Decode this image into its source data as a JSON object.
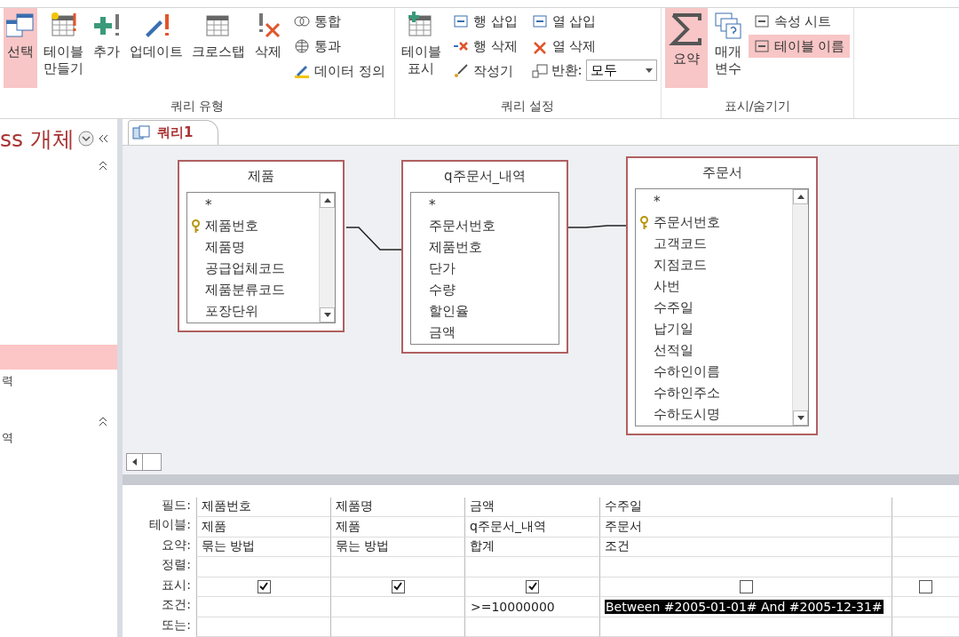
{
  "ribbon": {
    "groups": [
      {
        "label": "쿼리 유형",
        "large": [
          {
            "label": "선택",
            "selected": true
          },
          {
            "label": "테이블\n만들기",
            "selected": false
          },
          {
            "label": "추가",
            "selected": false
          },
          {
            "label": "업데이트",
            "selected": false
          },
          {
            "label": "크로스탭",
            "selected": false
          },
          {
            "label": "삭제",
            "selected": false
          }
        ],
        "small": [
          [
            {
              "label": "통합",
              "selected": false
            },
            {
              "label": "통과",
              "selected": false
            },
            {
              "label": "데이터 정의",
              "selected": false
            }
          ]
        ]
      },
      {
        "label": "쿼리 설정",
        "large": [
          {
            "label": "테이블\n표시",
            "selected": false
          }
        ],
        "small": [
          [
            {
              "label": "행 삽입",
              "selected": false
            },
            {
              "label": "행 삭제",
              "selected": false
            },
            {
              "label": "작성기",
              "selected": false
            }
          ],
          [
            {
              "label": "열 삽입",
              "selected": false
            },
            {
              "label": "열 삭제",
              "selected": false
            }
          ]
        ],
        "return": {
          "label": "반환:",
          "value": "모두"
        }
      },
      {
        "label": "표시/숨기기",
        "large": [
          {
            "label": "요약",
            "selected": true
          },
          {
            "label": "매개\n변수",
            "selected": false
          }
        ],
        "small": [
          [
            {
              "label": "속성 시트",
              "selected": false
            },
            {
              "label": "테이블 이름",
              "selected": true
            }
          ]
        ]
      }
    ]
  },
  "sidebar": {
    "title": "ss 개체",
    "items": [
      {
        "selected": true
      },
      {
        "label": "력",
        "selected": false
      },
      {
        "label": "역",
        "selected": false
      }
    ]
  },
  "tab": {
    "label": "쿼리1",
    "selected": true
  },
  "tables": [
    {
      "title": "제품",
      "fields": [
        {
          "name": "*",
          "key": false
        },
        {
          "name": "제품번호",
          "key": true
        },
        {
          "name": "제품명",
          "key": false
        },
        {
          "name": "공급업체코드",
          "key": false
        },
        {
          "name": "제품분류코드",
          "key": false
        },
        {
          "name": "포장단위",
          "key": false
        }
      ],
      "scroll": true
    },
    {
      "title": "q주문서_내역",
      "fields": [
        {
          "name": "*",
          "key": false
        },
        {
          "name": "주문서번호",
          "key": false
        },
        {
          "name": "제품번호",
          "key": false
        },
        {
          "name": "단가",
          "key": false
        },
        {
          "name": "수량",
          "key": false
        },
        {
          "name": "할인율",
          "key": false
        },
        {
          "name": "금액",
          "key": false
        }
      ],
      "scroll": false
    },
    {
      "title": "주문서",
      "fields": [
        {
          "name": "*",
          "key": false
        },
        {
          "name": "주문서번호",
          "key": true
        },
        {
          "name": "고객코드",
          "key": false
        },
        {
          "name": "지점코드",
          "key": false
        },
        {
          "name": "사번",
          "key": false
        },
        {
          "name": "수주일",
          "key": false
        },
        {
          "name": "납기일",
          "key": false
        },
        {
          "name": "선적일",
          "key": false
        },
        {
          "name": "수하인이름",
          "key": false
        },
        {
          "name": "수하인주소",
          "key": false
        },
        {
          "name": "수하도시명",
          "key": false
        }
      ],
      "scroll": true
    }
  ],
  "grid": {
    "row_labels": [
      "필드:",
      "테이블:",
      "요약:",
      "정렬:",
      "표시:",
      "조건:",
      "또는:"
    ],
    "columns": [
      {
        "field": "제품번호",
        "table": "제품",
        "total": "묶는 방법",
        "show": true
      },
      {
        "field": "제품명",
        "table": "제품",
        "total": "묶는 방법",
        "show": true
      },
      {
        "field": "금액",
        "table": "q주문서_내역",
        "total": "합계",
        "show": true,
        "criteria": {
          "text": ">=10000000",
          "selected": false
        }
      },
      {
        "field": "수주일",
        "table": "주문서",
        "total": "조건",
        "show": false,
        "criteria": {
          "text": "Between #2005-01-01# And #2005-12-31#",
          "selected": true
        }
      },
      {
        "show": false
      }
    ]
  }
}
